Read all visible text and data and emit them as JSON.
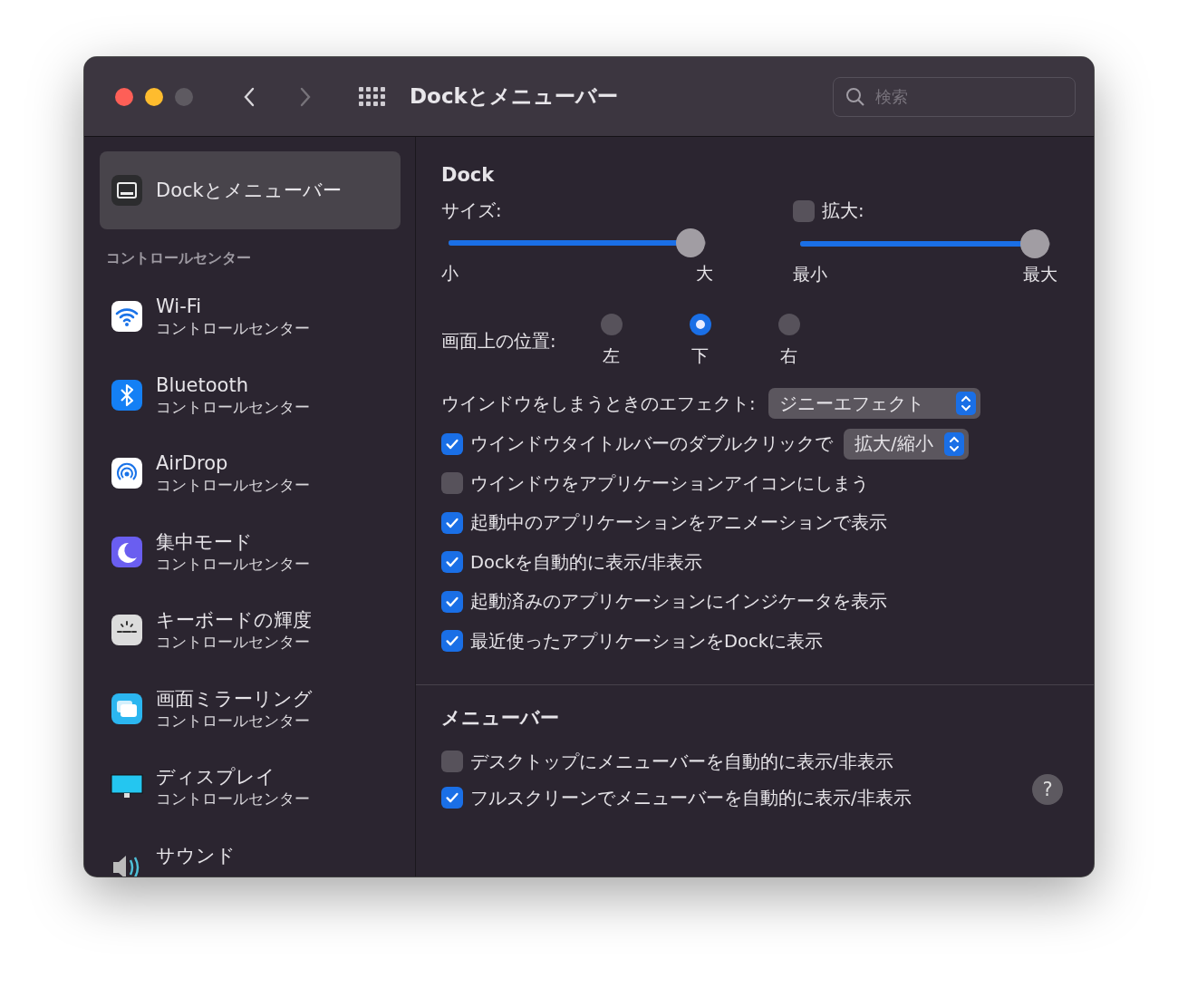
{
  "window": {
    "title": "Dockとメニューバー"
  },
  "search": {
    "placeholder": "検索"
  },
  "sidebar": {
    "top_item": {
      "kind": "dock",
      "label": "Dockとメニューバー",
      "selected": true
    },
    "section_title": "コントロールセンター",
    "items": [
      {
        "kind": "wifi",
        "label": "Wi-Fi",
        "subtitle": "コントロールセンター",
        "selected": false
      },
      {
        "kind": "bluetooth",
        "label": "Bluetooth",
        "subtitle": "コントロールセンター",
        "selected": false
      },
      {
        "kind": "airdrop",
        "label": "AirDrop",
        "subtitle": "コントロールセンター",
        "selected": false
      },
      {
        "kind": "focus",
        "label": "集中モード",
        "subtitle": "コントロールセンター",
        "selected": false
      },
      {
        "kind": "keyboard",
        "label": "キーボードの輝度",
        "subtitle": "コントロールセンター",
        "selected": false
      },
      {
        "kind": "mirroring",
        "label": "画面ミラーリング",
        "subtitle": "コントロールセンター",
        "selected": false
      },
      {
        "kind": "display",
        "label": "ディスプレイ",
        "subtitle": "コントロールセンター",
        "selected": false
      },
      {
        "kind": "sound",
        "label": "サウンド",
        "selected": false
      }
    ]
  },
  "dock": {
    "title": "Dock",
    "size": {
      "label": "サイズ:",
      "level": 0.94,
      "min_label": "小",
      "max_label": "大"
    },
    "magnification": {
      "label": "拡大:",
      "checked": false,
      "level": 0.94,
      "min_label": "最小",
      "max_label": "最大"
    },
    "position": {
      "label": "画面上の位置:",
      "options": [
        {
          "label": "左",
          "selected": false
        },
        {
          "label": "下",
          "selected": true
        },
        {
          "label": "右",
          "selected": false
        }
      ]
    },
    "effect": {
      "label": "ウインドウをしまうときのエフェクト:",
      "value": "ジニーエフェクト"
    },
    "options": [
      {
        "kind": "select",
        "label": "ウインドウタイトルバーのダブルクリックで",
        "checked": true,
        "value": "拡大/縮小"
      },
      {
        "kind": "plain",
        "label": "ウインドウをアプリケーションアイコンにしまう",
        "checked": false
      },
      {
        "kind": "plain",
        "label": "起動中のアプリケーションをアニメーションで表示",
        "checked": true
      },
      {
        "kind": "plain",
        "label": "Dockを自動的に表示/非表示",
        "checked": true
      },
      {
        "kind": "plain",
        "label": "起動済みのアプリケーションにインジケータを表示",
        "checked": true
      },
      {
        "kind": "plain",
        "label": "最近使ったアプリケーションをDockに表示",
        "checked": true
      }
    ]
  },
  "menu_bar": {
    "title": "メニューバー",
    "options": [
      {
        "label": "デスクトップにメニューバーを自動的に表示/非表示",
        "checked": false
      },
      {
        "label": "フルスクリーンでメニューバーを自動的に表示/非表示",
        "checked": true
      }
    ]
  },
  "help": {
    "label": "?"
  }
}
